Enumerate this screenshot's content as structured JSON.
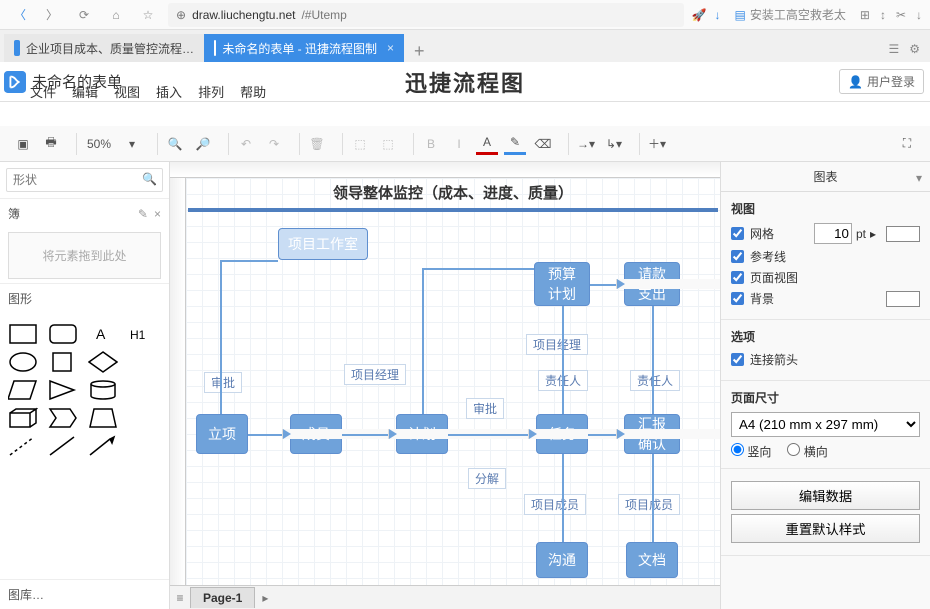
{
  "browser": {
    "url_host": "draw.liuchengtu.net",
    "url_path": "/#Utemp",
    "bookmark": "安装工高空救老太"
  },
  "tabs": {
    "inactive": "企业项目成本、质量管控流程…",
    "active": "未命名的表单 - 迅捷流程图制",
    "close": "×",
    "plus": "+"
  },
  "app": {
    "doc": "未命名的表单",
    "title": "迅捷流程图",
    "login": "用户登录"
  },
  "menu": {
    "file": "文件",
    "edit": "编辑",
    "view": "视图",
    "insert": "插入",
    "arrange": "排列",
    "help": "帮助"
  },
  "toolbar": {
    "zoom": "50%"
  },
  "left": {
    "search_ph": "形状",
    "scratch": "簿",
    "drop": "将元素拖到此处",
    "shapes": "图形",
    "lib": "图库…"
  },
  "canvas": {
    "header": "领导整体监控（成本、进度、质量）",
    "n_workshop": "项目工作室",
    "n_budget": "预算\n计划",
    "n_pay": "请款\n支出",
    "n_pm1": "项目经理",
    "n_pm2": "项目经理",
    "n_resp1": "责任人",
    "n_resp2": "责任人",
    "n_lixiang": "立项",
    "n_member": "成员",
    "n_plan": "计划",
    "n_task": "任务",
    "n_report": "汇报\n确认",
    "n_split": "分解",
    "n_approve": "审批",
    "n_approve2": "审批",
    "n_teammember1": "项目成员",
    "n_teammember2": "项目成员",
    "n_comm": "沟通",
    "n_doc": "文档"
  },
  "pages": {
    "p1": "Page-1"
  },
  "right": {
    "chart": "图表",
    "view": "视图",
    "grid": "网格",
    "grid_val": "10",
    "grid_unit": "pt",
    "guide": "参考线",
    "pageview": "页面视图",
    "bg": "背景",
    "options": "选项",
    "snap": "连接箭头",
    "pagesize": "页面尺寸",
    "size": "A4 (210 mm x 297 mm)",
    "portrait": "竖向",
    "landscape": "横向",
    "editdata": "编辑数据",
    "reset": "重置默认样式"
  }
}
